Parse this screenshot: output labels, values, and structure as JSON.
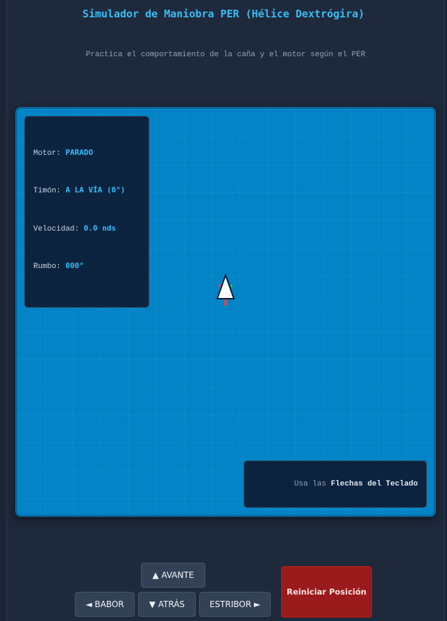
{
  "header": {
    "title": "Simulador de Maniobra PER (Hélice Dextrógira)",
    "subtitle": "Practica el comportamiento de la caña y el motor según el PER"
  },
  "status": {
    "motor_label": "Motor:",
    "motor_value": "PARADO",
    "rudder_label": "Timón:",
    "rudder_value": "A LA VÍA (0°)",
    "speed_label": "Velocidad:",
    "speed_value": "0.0 nds",
    "heading_label": "Rumbo:",
    "heading_value": "000°"
  },
  "hint": {
    "prefix": "Usa las ",
    "keys": "Flechas del Teclado"
  },
  "controls": {
    "ahead": "▲ AVANTE",
    "port": "◄ BABOR",
    "astern": "▼ ATRÁS",
    "starboard": "ESTRIBOR ►",
    "reset": "Reiniciar Posición"
  },
  "colors": {
    "sea": "#0284c7",
    "accent": "#38bdf8",
    "port_light": "#ef4444",
    "starboard_light": "#22c55e",
    "reset_button": "#991b1b"
  }
}
